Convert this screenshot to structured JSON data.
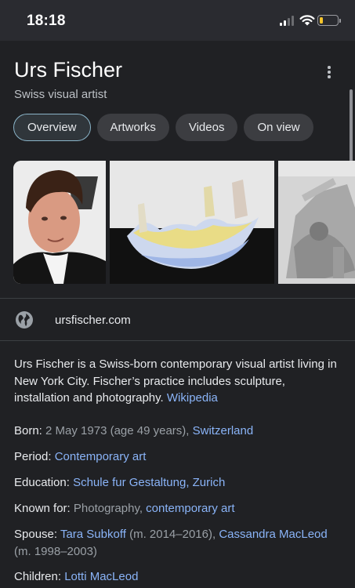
{
  "status": {
    "time": "18:18",
    "battery_level": 0.18,
    "colors": {
      "battery": "#f6c52a",
      "signal_on": "#ffffff",
      "signal_off": "#6b6c70"
    }
  },
  "entity": {
    "title": "Urs Fischer",
    "subtitle": "Swiss visual artist"
  },
  "tabs": [
    {
      "label": "Overview",
      "active": true
    },
    {
      "label": "Artworks",
      "active": false
    },
    {
      "label": "Videos",
      "active": false
    },
    {
      "label": "On view",
      "active": false
    }
  ],
  "website": {
    "icon": "globe-icon",
    "label": "ursfischer.com"
  },
  "description": {
    "text": "Urs Fischer is a Swiss-born contemporary visual artist living in New York City. Fischer’s practice includes sculpture, installation and photography. ",
    "source": "Wikipedia"
  },
  "facts": {
    "born": {
      "label": "Born:",
      "value": " 2 May 1973 (age 49 years), ",
      "link": "Switzerland"
    },
    "period": {
      "label": "Period:",
      "link": "Contemporary art"
    },
    "education": {
      "label": "Education:",
      "link": "Schule fur Gestaltung, Zurich"
    },
    "known_for": {
      "label": "Known for:",
      "value": " Photography, ",
      "link": "contemporary art"
    },
    "spouse": {
      "label": "Spouse:",
      "link1": "Tara Subkoff",
      "value1": " (m. 2014–2016), ",
      "link2": "Cassandra MacLeod",
      "value2": "(m. 1998–2003)"
    },
    "children": {
      "label": "Children:",
      "link": "Lotti MacLeod"
    }
  },
  "colors": {
    "link": "#8ab4f8",
    "background": "#202124",
    "chip": "#3c3d41"
  }
}
